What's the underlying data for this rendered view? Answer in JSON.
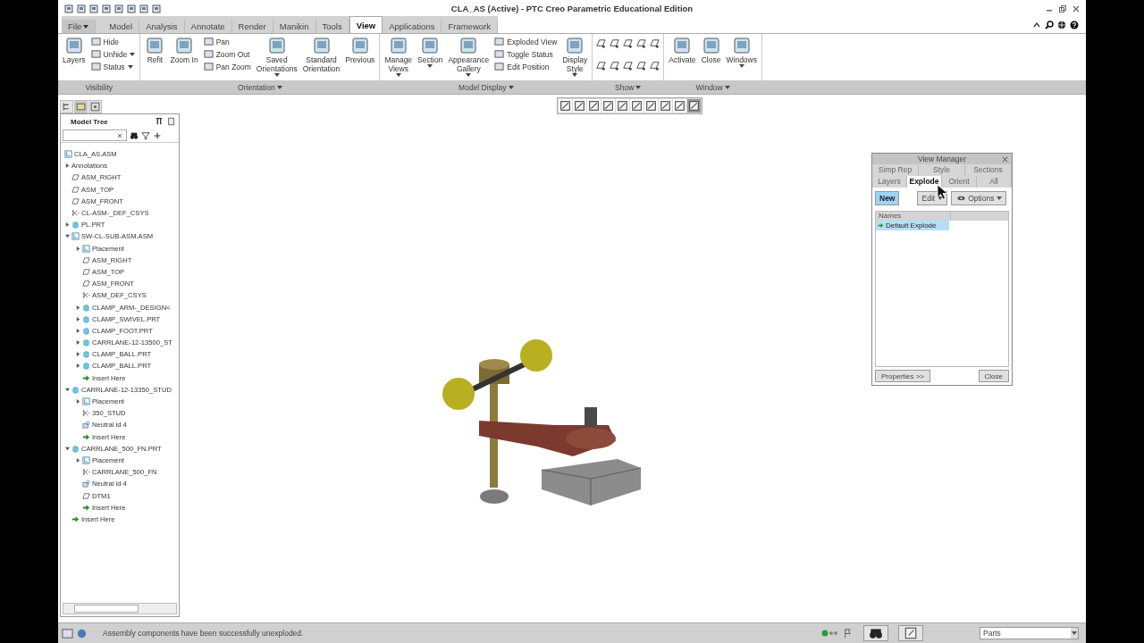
{
  "window": {
    "title": "CLA_AS (Active) - PTC Creo Parametric Educational Edition"
  },
  "tabs": [
    {
      "label": "File",
      "kind": "menu",
      "selected": false
    },
    {
      "label": "Model",
      "kind": "tab",
      "selected": false
    },
    {
      "label": "Analysis",
      "kind": "tab",
      "selected": false
    },
    {
      "label": "Annotate",
      "kind": "tab",
      "selected": false
    },
    {
      "label": "Render",
      "kind": "tab",
      "selected": false
    },
    {
      "label": "Manikin",
      "kind": "tab",
      "selected": false
    },
    {
      "label": "Tools",
      "kind": "tab",
      "selected": false
    },
    {
      "label": "View",
      "kind": "tab",
      "selected": true
    },
    {
      "label": "Applications",
      "kind": "tab",
      "selected": false
    },
    {
      "label": "Framework",
      "kind": "tab",
      "selected": false
    }
  ],
  "ribbon": {
    "groups": [
      {
        "label": "Visibility",
        "menu": false,
        "columns": [
          {
            "kind": "large",
            "label": "Layers",
            "dropdown": false
          },
          {
            "kind": "stack",
            "items": [
              {
                "label": "Hide",
                "dropdown": false
              },
              {
                "label": "Unhide",
                "dropdown": true
              },
              {
                "label": "Status",
                "dropdown": true
              }
            ]
          }
        ]
      },
      {
        "label": "Orientation",
        "menu": true,
        "columns": [
          {
            "kind": "large",
            "label": "Refit",
            "dropdown": false
          },
          {
            "kind": "large",
            "label": "Zoom In",
            "dropdown": false
          },
          {
            "kind": "stack",
            "items": [
              {
                "label": "Pan",
                "dropdown": false
              },
              {
                "label": "Zoom Out",
                "dropdown": false
              },
              {
                "label": "Pan Zoom",
                "dropdown": false
              }
            ]
          },
          {
            "kind": "large",
            "label": "Saved\nOrientations",
            "dropdown": true
          },
          {
            "kind": "large",
            "label": "Standard\nOrientation",
            "dropdown": false
          },
          {
            "kind": "large",
            "label": "Previous",
            "dropdown": false
          }
        ]
      },
      {
        "label": "Model Display",
        "menu": true,
        "columns": [
          {
            "kind": "large",
            "label": "Manage\nViews",
            "dropdown": true
          },
          {
            "kind": "large",
            "label": "Section",
            "dropdown": true
          },
          {
            "kind": "large",
            "label": "Appearance\nGallery",
            "dropdown": true
          },
          {
            "kind": "stack",
            "items": [
              {
                "label": "Exploded View",
                "dropdown": false
              },
              {
                "label": "Toggle Status",
                "dropdown": false
              },
              {
                "label": "Edit Position",
                "dropdown": false
              }
            ]
          },
          {
            "kind": "large",
            "label": "Display\nStyle",
            "dropdown": true
          }
        ]
      },
      {
        "label": "Show",
        "menu": true,
        "columns": [
          {
            "kind": "icons"
          }
        ]
      },
      {
        "label": "Window",
        "menu": true,
        "columns": [
          {
            "kind": "large",
            "label": "Activate",
            "dropdown": false
          },
          {
            "kind": "large",
            "label": "Close",
            "dropdown": false
          },
          {
            "kind": "large",
            "label": "Windows",
            "dropdown": true
          }
        ]
      }
    ]
  },
  "model_tree": {
    "title": "Model Tree",
    "items": [
      {
        "label": "CLA_AS.ASM",
        "kind": "assembly",
        "children": [
          {
            "label": "Annotations",
            "kind": "annotations",
            "expanded": false
          },
          {
            "label": "ASM_RIGHT",
            "kind": "plane"
          },
          {
            "label": "ASM_TOP",
            "kind": "plane"
          },
          {
            "label": "ASM_FRONT",
            "kind": "plane"
          },
          {
            "label": "CL-ASM-_DEF_CSYS",
            "kind": "csys"
          },
          {
            "label": "PL.PRT",
            "kind": "part",
            "expanded": false
          },
          {
            "label": "SW-CL-SUB-ASM.ASM",
            "kind": "assembly",
            "expanded": true,
            "children": [
              {
                "label": "Placement",
                "kind": "placement",
                "expanded": false
              },
              {
                "label": "ASM_RIGHT",
                "kind": "plane"
              },
              {
                "label": "ASM_TOP",
                "kind": "plane"
              },
              {
                "label": "ASM_FRONT",
                "kind": "plane"
              },
              {
                "label": "ASM_DEF_CSYS",
                "kind": "csys"
              },
              {
                "label": "CLAMP_ARM-_DESIGN<",
                "kind": "part",
                "expanded": false
              },
              {
                "label": "CLAMP_SWIVEL.PRT",
                "kind": "part",
                "expanded": false
              },
              {
                "label": "CLAMP_FOOT.PRT",
                "kind": "part",
                "expanded": false
              },
              {
                "label": "CARRLANE-12-13500_ST",
                "kind": "part",
                "expanded": false
              },
              {
                "label": "CLAMP_BALL.PRT",
                "kind": "part",
                "expanded": false
              },
              {
                "label": "CLAMP_BALL.PRT",
                "kind": "part",
                "expanded": false
              },
              {
                "label": "Insert Here",
                "kind": "insert"
              }
            ]
          },
          {
            "label": "CARRLANE-12-13350_STUD",
            "kind": "part",
            "expanded": true,
            "children": [
              {
                "label": "Placement",
                "kind": "placement",
                "expanded": false
              },
              {
                "label": "350_STUD",
                "kind": "csys"
              },
              {
                "label": "Neutral id 4",
                "kind": "feature"
              },
              {
                "label": "Insert Here",
                "kind": "insert"
              }
            ]
          },
          {
            "label": "CARRLANE_500_FN.PRT",
            "kind": "part",
            "expanded": true,
            "children": [
              {
                "label": "Placement",
                "kind": "placement",
                "expanded": false
              },
              {
                "label": "CARRLANE_500_FN",
                "kind": "csys"
              },
              {
                "label": "Neutral id 4",
                "kind": "feature"
              },
              {
                "label": "DTM1",
                "kind": "plane"
              },
              {
                "label": "Insert Here",
                "kind": "insert"
              }
            ]
          },
          {
            "label": "Insert Here",
            "kind": "insert"
          }
        ]
      }
    ]
  },
  "view_manager": {
    "title": "View Manager",
    "tab_rows": [
      {
        "tabs": [
          {
            "label": "Simp Rep",
            "selected": false
          },
          {
            "label": "Style",
            "selected": false
          },
          {
            "label": "Sections",
            "selected": false
          }
        ]
      },
      {
        "tabs": [
          {
            "label": "Layers",
            "selected": false
          },
          {
            "label": "Explode",
            "selected": true
          },
          {
            "label": "Orient",
            "selected": false
          },
          {
            "label": "All",
            "selected": false
          }
        ]
      }
    ],
    "buttons": [
      {
        "label": "New",
        "kind": "primary"
      },
      {
        "label": "Edit",
        "kind": "menu"
      },
      {
        "label": "Options",
        "kind": "options"
      }
    ],
    "list": {
      "column": "Names",
      "items": [
        {
          "label": "Default Explode",
          "selected": true
        }
      ]
    },
    "footer": [
      "Properties >>",
      "Close"
    ]
  },
  "status_bar": {
    "message": "Assembly components have been successfully unexploded.",
    "filter": "Parts"
  }
}
